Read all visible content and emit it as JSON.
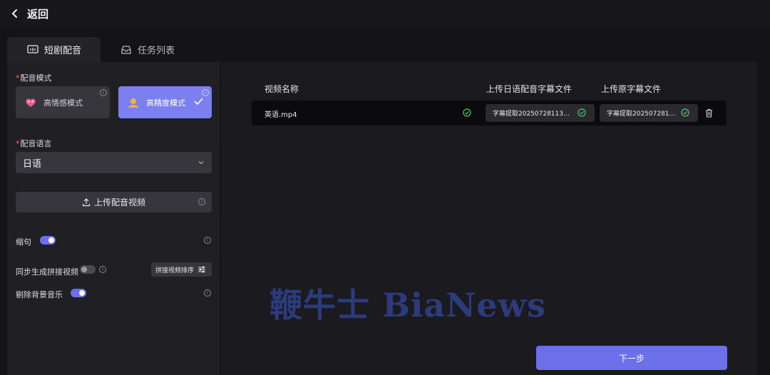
{
  "header": {
    "back_label": "返回"
  },
  "tabs": [
    {
      "label": "短剧配音",
      "icon": "dubbing-icon",
      "active": true
    },
    {
      "label": "任务列表",
      "icon": "inbox-icon",
      "active": false
    }
  ],
  "settings": {
    "dub_mode": {
      "label": "配音模式",
      "options": [
        {
          "label": "高情感模式",
          "icon": "heart-mask-icon",
          "selected": false
        },
        {
          "label": "高精度模式",
          "icon": "person-icon",
          "selected": true
        }
      ]
    },
    "dub_language": {
      "label": "配音语言",
      "value": "日语"
    },
    "upload_button": {
      "label": "上传配音视频"
    },
    "condense": {
      "label": "缩句",
      "on": true
    },
    "sync_splice": {
      "label": "同步生成拼接视频",
      "on": false,
      "sort_label": "拼接视频排序"
    },
    "remove_bgm": {
      "label": "剔除背景音乐",
      "on": true
    }
  },
  "table": {
    "headers": [
      "视频名称",
      "上传日语配音字幕文件",
      "上传原字幕文件"
    ],
    "rows": [
      {
        "video_name": "英语.mp4",
        "dub_subtitle": "字幕提取2025072811356U...",
        "orig_subtitle": "字幕提取20250728111..."
      }
    ]
  },
  "watermark": "鞭牛士 BiaNews",
  "next_button": {
    "label": "下一步"
  },
  "colors": {
    "accent": "#7b7ff0",
    "primary_button": "#6b6fe8",
    "success": "#4cc46a"
  }
}
